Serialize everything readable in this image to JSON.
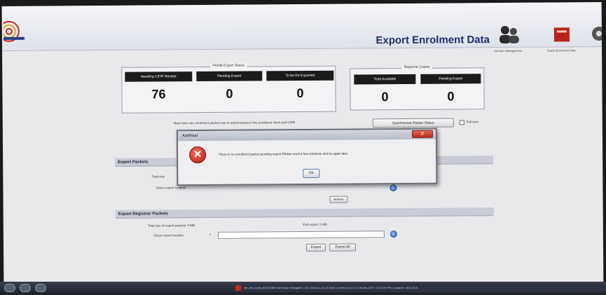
{
  "header": {
    "page_title": "Export Enrolment Data",
    "toolbar": [
      {
        "icon": "operators-icon",
        "caption": "Operator Management"
      },
      {
        "icon": "export-icon",
        "caption": "Export Enrolment Data"
      },
      {
        "icon": "settings-icon",
        "caption": ""
      }
    ]
  },
  "profile_status": {
    "title": "Profile Export Status",
    "columns": [
      {
        "label": "Awaiting CIDR Receipt",
        "value": "76"
      },
      {
        "label": "Pending Export",
        "value": "0"
      },
      {
        "label": "To be Re-Exported",
        "value": "0"
      }
    ]
  },
  "register_copies": {
    "title": "Registrar Copies",
    "columns": [
      {
        "label": "Total Available",
        "value": "0"
      },
      {
        "label": "Pending Export",
        "value": "0"
      }
    ]
  },
  "sync": {
    "notice": "More than one enrolment packets are in transit between this enrolment client and CIDR",
    "button_label": "Synchronize Packet Status",
    "checkbox_label": "Full sync"
  },
  "export_packets": {
    "title": "Export Packets",
    "total_label": "Total size",
    "location_label": "Select export location",
    "refresh_label": "Refresh"
  },
  "registrar_packets": {
    "title": "Export Registrar Packets",
    "total_label": "Total size of export packets: 0 MB",
    "full_export_label": "Full export: 0 MB",
    "location_label": "Select export location",
    "required_mark": "*",
    "location_value": "",
    "export_button": "Export",
    "export_all_button": "Export All"
  },
  "dialog": {
    "title": "Aadhaar",
    "message": "There is no enrolment packet pending export.Please enrol a few residents and try again later.",
    "ok_label": "OK",
    "close_label": "X"
  },
  "taskbar": {
    "status_text": "stn_enc_hosh_9S272300 Sunil Arjun Sanganle | 127-2016-11-11-27-9010 | version 3.3.1.2 | 15-Dec-2017 12:13:19 PM | Location: 18.5,73.8"
  },
  "colors": {
    "column_header_bg": "#1b1b1b",
    "title_color": "#1e2f6a",
    "error_red": "#c0140c"
  }
}
